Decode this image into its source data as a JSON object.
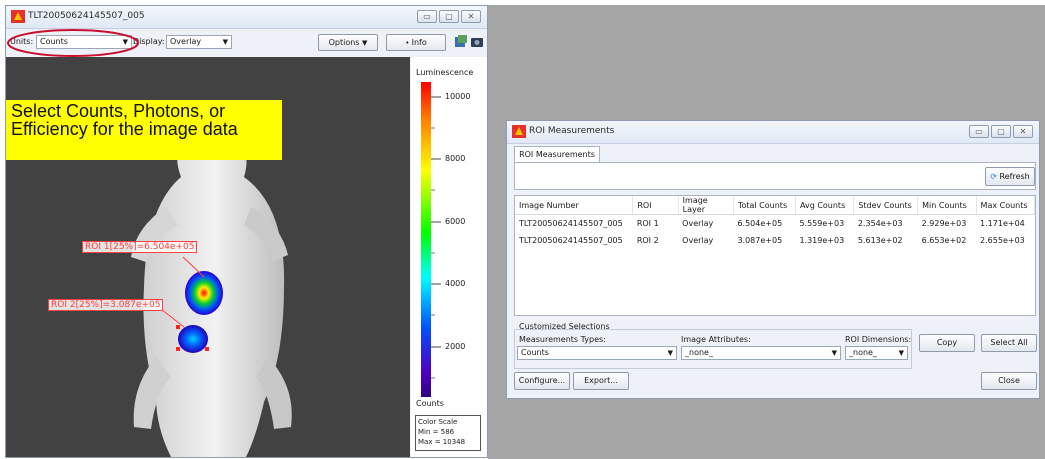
{
  "image_window": {
    "title": "TLT20050624145507_005",
    "units_label": "Units:",
    "units_value": "Counts",
    "display_label": "Display:",
    "display_value": "Overlay",
    "options_label": "Options",
    "info_label": "Info",
    "callout_text": "Select Counts, Photons, or Efficiency for the image data",
    "roi1_label": "ROI 1[25%]=6.504e+05",
    "roi2_label": "ROI 2[25%]=3.087e+05",
    "colorbar": {
      "title": "Luminescence",
      "ticks": [
        "10000",
        "8000",
        "6000",
        "4000",
        "2000"
      ],
      "units": "Counts",
      "scale_title": "Color Scale",
      "scale_min": "Min = 586",
      "scale_max": "Max = 10348"
    }
  },
  "roi_window": {
    "title": "ROI Measurements",
    "tab_label": "ROI Measurements",
    "refresh_label": "Refresh",
    "table": {
      "headers": [
        "Image Number",
        "ROI",
        "Image Layer",
        "Total Counts",
        "Avg Counts",
        "Stdev Counts",
        "Min Counts",
        "Max Counts"
      ],
      "rows": [
        [
          "TLT20050624145507_005",
          "ROI 1",
          "Overlay",
          "6.504e+05",
          "5.559e+03",
          "2.354e+03",
          "2.929e+03",
          "1.171e+04"
        ],
        [
          "TLT20050624145507_005",
          "ROI 2",
          "Overlay",
          "3.087e+05",
          "1.319e+03",
          "5.613e+02",
          "6.653e+02",
          "2.655e+03"
        ]
      ]
    },
    "custom_label": "Customized Selections",
    "meas_label": "Measurements Types:",
    "meas_value": "Counts",
    "attr_label": "Image Attributes:",
    "attr_value": "_none_",
    "dim_label": "ROI Dimensions:",
    "dim_value": "_none_",
    "copy_label": "Copy",
    "select_all_label": "Select All",
    "configure_label": "Configure...",
    "export_label": "Export...",
    "close_label": "Close"
  },
  "colors": {
    "callout_bg": "#ffff00",
    "annotation_red": "#c8102e",
    "background_gray": "#a6a6a6",
    "roi_label": "#ff4040"
  }
}
